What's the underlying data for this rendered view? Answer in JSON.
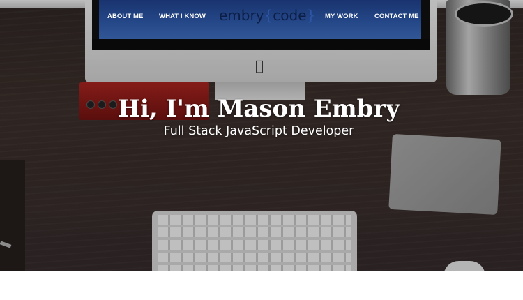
{
  "nav": {
    "items": [
      {
        "label": "ABOUT ME"
      },
      {
        "label": "WHAT I KNOW"
      },
      {
        "label": "MY WORK"
      },
      {
        "label": "CONTACT ME"
      }
    ],
    "logo": {
      "prefix": "embry",
      "open": "{",
      "word": "code",
      "close": "}"
    }
  },
  "hero": {
    "headline": "Hi, I'm Mason Embry",
    "subtitle": "Full Stack JavaScript Developer"
  },
  "icons": {
    "apple": "apple-logo-icon"
  },
  "colors": {
    "nav_bg": "#2d57a6",
    "logo_text": "#0c1e46",
    "hero_text": "#ffffff",
    "page_bg": "#ffffff"
  }
}
